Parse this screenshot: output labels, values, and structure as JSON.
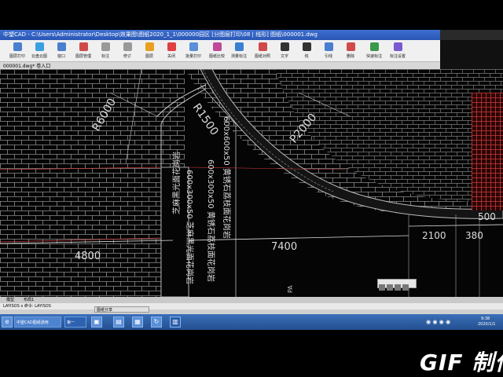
{
  "window": {
    "title": "中望CAD  -  C:\\Users\\Administrator\\Desktop\\效果图\\图纸2020_1_1\\000000园区  [分图层打印\\08 | 线形]  图纸\\000001.dwg"
  },
  "ribbon": {
    "buttons": [
      {
        "label": "图层打印",
        "icon": "layer-print-icon",
        "color": "#4a7fd0"
      },
      {
        "label": "云盘云图",
        "icon": "cloud-icon",
        "color": "#3aa0e0"
      },
      {
        "label": "窗口",
        "icon": "window-icon",
        "color": "#4a7fd0"
      },
      {
        "label": "图层管理",
        "icon": "layer-manager-icon",
        "color": "#d04a4a"
      },
      {
        "label": "标注",
        "icon": "dimension-icon",
        "color": "#999999"
      },
      {
        "label": "修订",
        "icon": "revise-icon",
        "color": "#999999"
      },
      {
        "label": "图层",
        "icon": "layers-icon",
        "color": "#e8a020"
      },
      {
        "label": "关闭",
        "icon": "close-doc-icon",
        "color": "#e04040"
      },
      {
        "label": "批量打印",
        "icon": "batch-print-icon",
        "color": "#5b8fd8"
      },
      {
        "label": "图纸比较",
        "icon": "compare-icon",
        "color": "#c04a9a"
      },
      {
        "label": "测量标注",
        "icon": "measure-icon",
        "color": "#3a7fd0"
      },
      {
        "label": "图纸对照",
        "icon": "contrast-icon",
        "color": "#d04a4a"
      },
      {
        "label": "文字",
        "icon": "text-icon",
        "color": "#333333"
      },
      {
        "label": "线",
        "icon": "line-icon",
        "color": "#333333"
      },
      {
        "label": "引线",
        "icon": "leader-icon",
        "color": "#4a7fd0"
      },
      {
        "label": "删除",
        "icon": "erase-icon",
        "color": "#d04a4a"
      },
      {
        "label": "快速标注",
        "icon": "quick-dim-icon",
        "color": "#3a9a4a"
      },
      {
        "label": "标注设置",
        "icon": "dim-settings-icon",
        "color": "#7a5ad0"
      }
    ]
  },
  "doc_tab": {
    "label": "000001.dwg*  卷入口"
  },
  "drawing": {
    "labels": {
      "r6000": "R6000",
      "r1500": "R1500",
      "p2000": "P2000",
      "dim_4800": "4800",
      "dim_7400": "7400",
      "dim_2100": "2100",
      "dim_380": "380",
      "dim_500": "500",
      "note_1": "600x600x50 黄锈石荔枝面花岗岩",
      "note_2": "600x300x50 黄锈石荔枝面花岗岩",
      "note_3": "600x300x50 芝麻黑光面花岗岩",
      "note_4": "芝麻黑光面花岗岩",
      "pa": "PA"
    }
  },
  "layout_tabs": {
    "model": "模型",
    "layout": "布局1"
  },
  "cmdline": {
    "text": "LAYISOS  x  命令: LAYISOS"
  },
  "taskbar": {
    "item_1": "中望CAD图纸通用",
    "item_2": "第一",
    "item_3": "图纸分享",
    "tray_time": "9:38",
    "tray_date": "2020/1/1"
  },
  "watermark": "GIF 制作"
}
